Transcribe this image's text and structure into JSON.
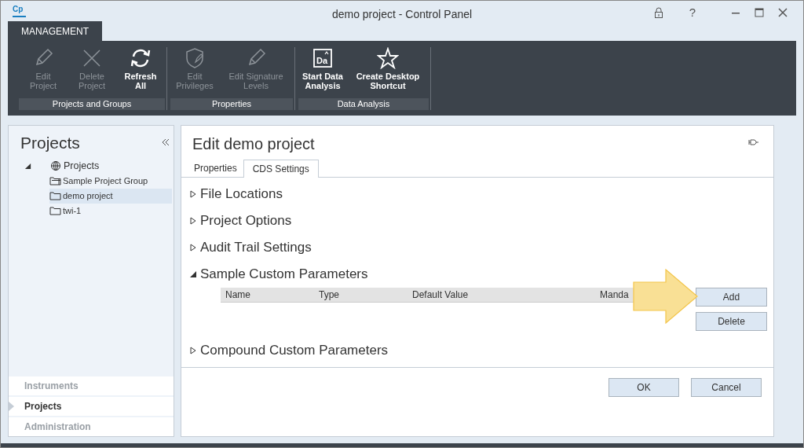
{
  "window": {
    "logo": "Cp",
    "title": "demo project - Control Panel",
    "help": "?"
  },
  "ribbon": {
    "tabs": [
      {
        "label": "MANAGEMENT",
        "selected": true
      }
    ],
    "groups": [
      {
        "label": "Projects and Groups",
        "buttons": [
          {
            "label": "Edit Project",
            "disabled": true
          },
          {
            "label": "Delete Project",
            "disabled": true
          },
          {
            "label": "Refresh All",
            "disabled": false
          }
        ]
      },
      {
        "label": "Properties",
        "buttons": [
          {
            "label": "Edit Privileges",
            "disabled": true
          },
          {
            "label": "Edit Signature Levels",
            "disabled": true
          }
        ]
      },
      {
        "label": "Data Analysis",
        "buttons": [
          {
            "icon_text": "Da",
            "label": "Start Data Analysis",
            "disabled": false
          },
          {
            "label": "Create Desktop Shortcut",
            "disabled": false
          }
        ]
      }
    ]
  },
  "sidebar": {
    "title": "Projects",
    "tree": [
      {
        "label": "Projects",
        "expanded": true,
        "selected": false,
        "children": [
          {
            "label": "Sample Project Group",
            "selected": false
          },
          {
            "label": "demo project",
            "selected": true
          },
          {
            "label": "twi-1",
            "selected": false
          }
        ]
      }
    ],
    "nav": [
      {
        "label": "Instruments",
        "selected": false
      },
      {
        "label": "Projects",
        "selected": true
      },
      {
        "label": "Administration",
        "selected": false
      }
    ]
  },
  "editor": {
    "title": "Edit demo project",
    "tabs": [
      {
        "label": "Properties",
        "selected": false
      },
      {
        "label": "CDS Settings",
        "selected": true
      }
    ],
    "sections": [
      {
        "title": "File Locations",
        "expanded": false
      },
      {
        "title": "Project Options",
        "expanded": false
      },
      {
        "title": "Audit Trail Settings",
        "expanded": false
      },
      {
        "title": "Sample Custom Parameters",
        "expanded": true,
        "columns": [
          "Name",
          "Type",
          "Default Value",
          "Manda"
        ],
        "buttons": [
          "Add",
          "Delete"
        ]
      },
      {
        "title": "Compound Custom Parameters",
        "expanded": false
      }
    ],
    "buttons": [
      "OK",
      "Cancel"
    ]
  }
}
